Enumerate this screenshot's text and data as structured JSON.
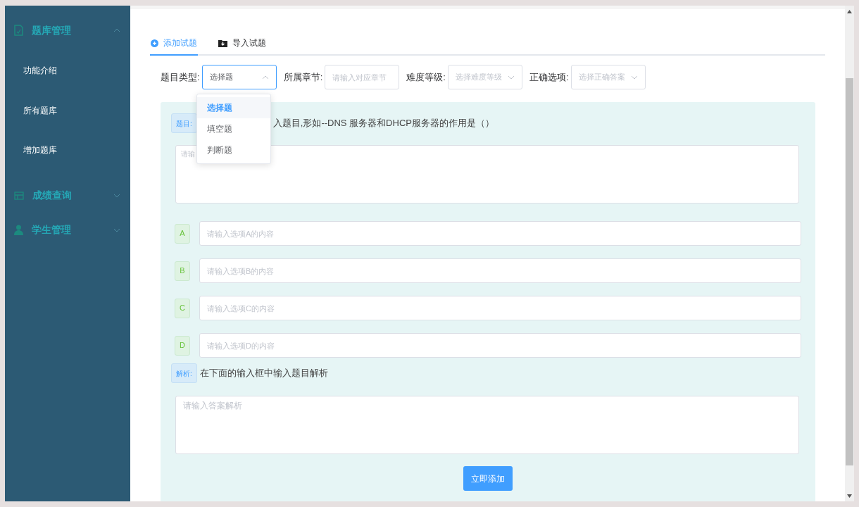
{
  "sidebar": {
    "groups": [
      {
        "label": "题库管理",
        "expanded": true,
        "children": [
          {
            "label": "功能介绍"
          },
          {
            "label": "所有题库"
          },
          {
            "label": "增加题库"
          }
        ]
      },
      {
        "label": "成绩查询",
        "expanded": false
      },
      {
        "label": "学生管理",
        "expanded": false
      }
    ]
  },
  "tabs": [
    {
      "label": "添加试题",
      "selected": true
    },
    {
      "label": "导入试题",
      "selected": false
    }
  ],
  "filters": [
    {
      "kind": "select",
      "label": "题目类型:",
      "value": "选择题",
      "open": true
    },
    {
      "kind": "input",
      "label": "所属章节:",
      "placeholder": "请输入对应章节"
    },
    {
      "kind": "select",
      "label": "难度等级:",
      "placeholder": "选择难度等级",
      "open": false
    },
    {
      "kind": "select",
      "label": "正确选项:",
      "placeholder": "选择正确答案",
      "open": false
    }
  ],
  "type_dropdown": {
    "options": [
      {
        "label": "选择题",
        "selected": true
      },
      {
        "label": "填空题",
        "selected": false
      },
      {
        "label": "判断题",
        "selected": false
      }
    ]
  },
  "question": {
    "tag": "题目:",
    "hint": "入题目,形如--DNS 服务器和DHCP服务器的作用是（）",
    "placeholder": "请输"
  },
  "options": [
    {
      "letter": "A",
      "placeholder": "请输入选项A的内容"
    },
    {
      "letter": "B",
      "placeholder": "请输入选项B的内容"
    },
    {
      "letter": "C",
      "placeholder": "请输入选项C的内容"
    },
    {
      "letter": "D",
      "placeholder": "请输入选项D的内容"
    }
  ],
  "analysis": {
    "tag": "解析:",
    "hint": "在下面的输入框中输入题目解析",
    "placeholder": "请输入答案解析"
  },
  "submit": "立即添加"
}
